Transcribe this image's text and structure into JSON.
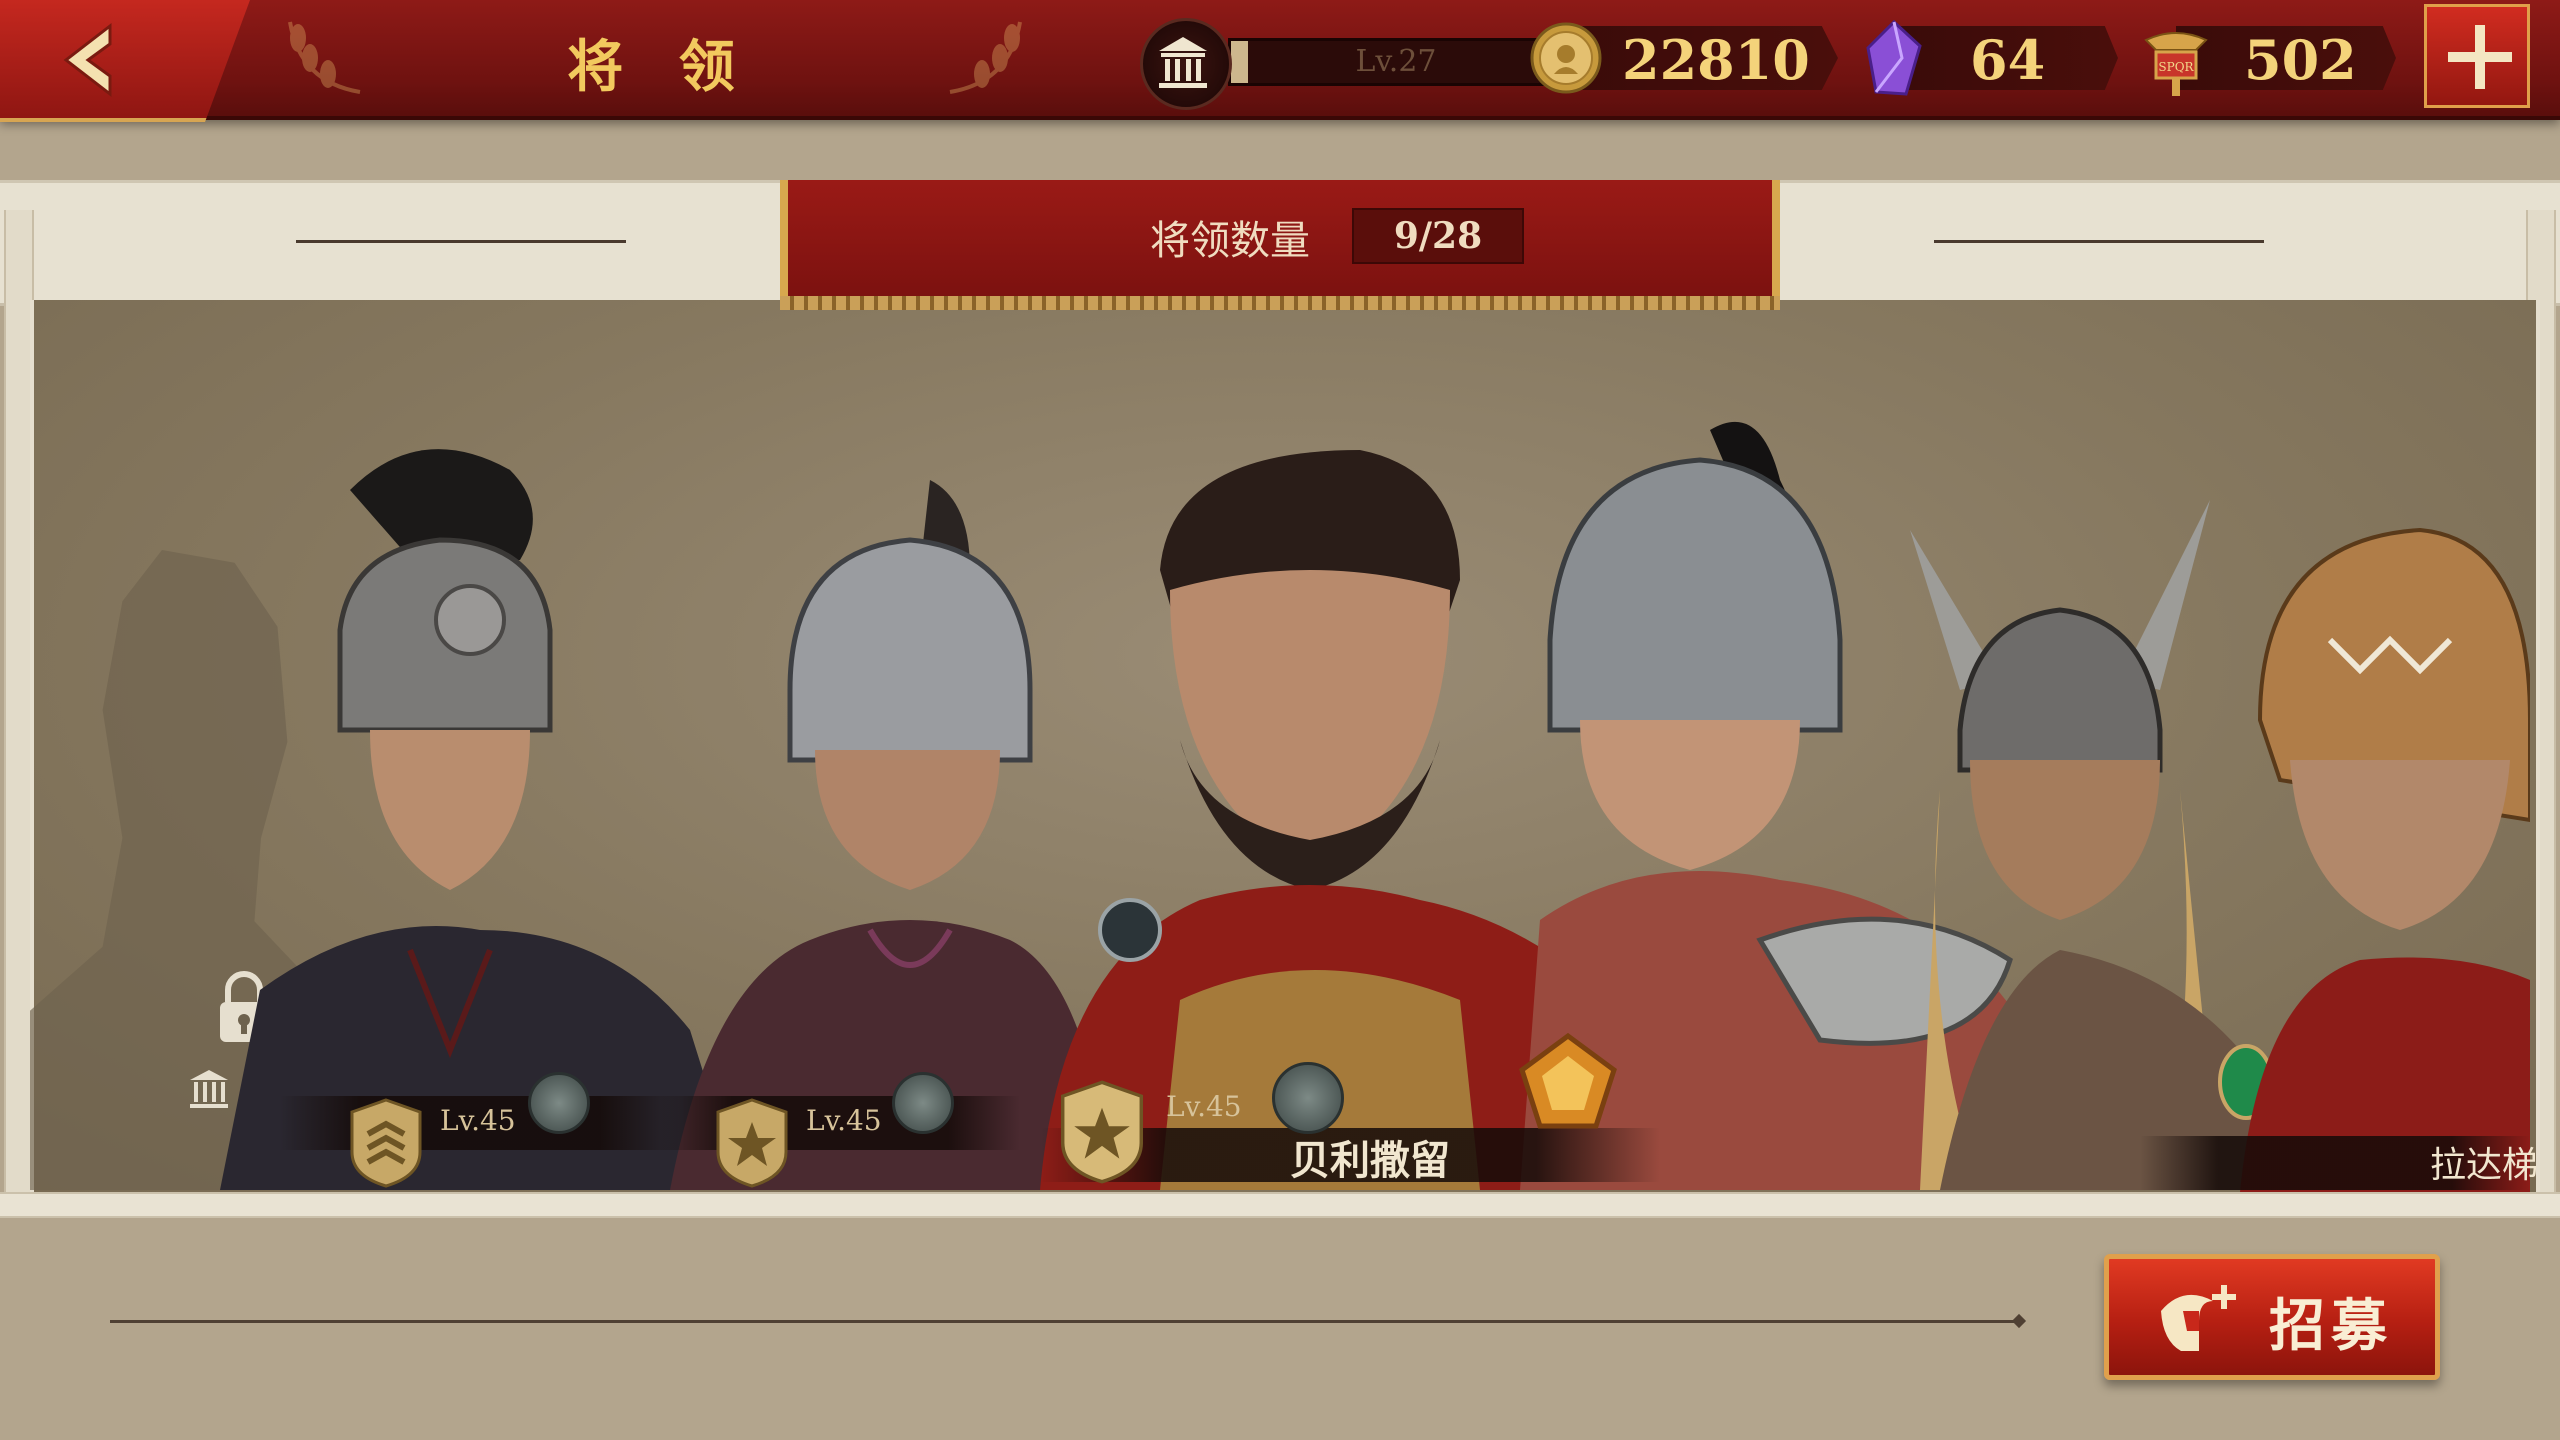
{
  "header": {
    "title": "将 领",
    "level_text": "Lv.27",
    "level_progress": 0.05,
    "resources": [
      {
        "name": "coins",
        "value": "22810"
      },
      {
        "name": "gems",
        "value": "64"
      },
      {
        "name": "spqr",
        "value": "502"
      }
    ]
  },
  "banner": {
    "label": "将领数量",
    "count": "9/28"
  },
  "heroes": [
    {
      "level": "Lv.45"
    },
    {
      "level": "Lv.45"
    },
    {
      "level": "Lv.45",
      "name": "贝利撒留"
    },
    {
      "name": "拉达梯"
    }
  ],
  "recruit_label": "招募",
  "colors": {
    "topbar": "#7a1411",
    "gold_text": "#f2c95e",
    "panel": "#e7e1d1",
    "stage": "#8c7e66",
    "recruit_button": "#c8281a"
  }
}
